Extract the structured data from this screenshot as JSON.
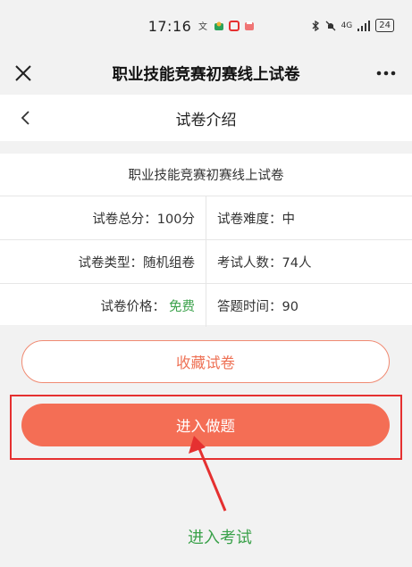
{
  "status_bar": {
    "time": "17:16",
    "battery": "24",
    "network": "4G"
  },
  "header": {
    "title": "职业技能竞赛初赛线上试卷"
  },
  "sub_header": {
    "title": "试卷介绍"
  },
  "card": {
    "title": "职业技能竞赛初赛线上试卷",
    "rows": [
      {
        "left": "试卷总分：100分",
        "right": "试卷难度：中"
      },
      {
        "left": "试卷类型：随机组卷",
        "right": "考试人数：74人"
      },
      {
        "left_label": "试卷价格：",
        "left_value": "免费",
        "right": "答题时间：90"
      }
    ]
  },
  "buttons": {
    "favorite": "收藏试卷",
    "enter": "进入做题"
  },
  "annotation": {
    "text": "进入考试",
    "color": "#3aa14a",
    "box_color": "#e53030"
  },
  "colors": {
    "accent": "#f46e55",
    "free": "#3aa14a"
  }
}
